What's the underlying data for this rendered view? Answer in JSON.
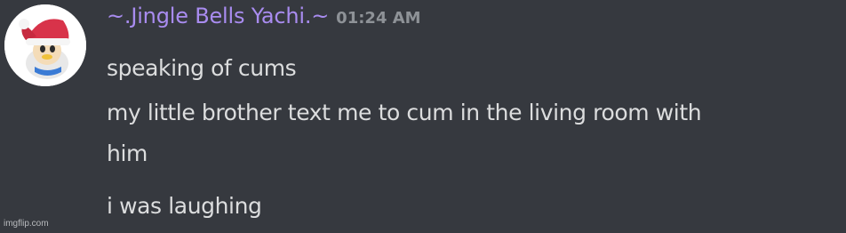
{
  "message": {
    "author": {
      "name": "~.Jingle Bells Yachi.~",
      "name_color": "#a98cf0"
    },
    "timestamp": "01:24 AM",
    "timestamp_color": "#8e9297",
    "avatar_icon": "santa-hat-avatar-icon",
    "lines": [
      "speaking of cums",
      "my little brother text me to cum in the living room with",
      "him",
      "i was laughing"
    ]
  },
  "watermark": "imgflip.com",
  "colors": {
    "background": "#36393f",
    "text": "#dcddde"
  }
}
